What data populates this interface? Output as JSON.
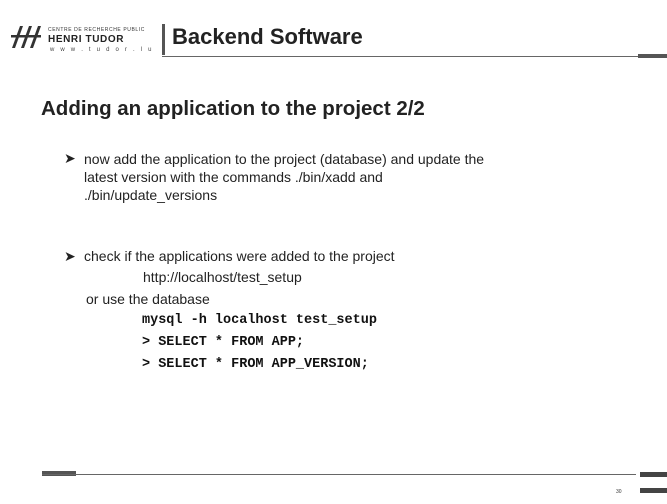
{
  "logo": {
    "small_text": "CENTRE DE RECHERCHE PUBLIC",
    "name": "HENRI TUDOR",
    "url": "w w w . t u d o r . l u"
  },
  "header": {
    "title": "Backend Software"
  },
  "slide": {
    "heading": "Adding an application to the project 2/2",
    "bullet_glyph": "➤",
    "bullet1": {
      "line1": "now add the application to the project (database) and update the",
      "line2": "latest version with the commands ./bin/xadd and",
      "line3": "./bin/update_versions"
    },
    "bullet2": {
      "line1": "check if the applications were added to the project",
      "url": "http://localhost/test_setup",
      "alt": "or use the database",
      "code1": "mysql -h localhost test_setup",
      "code2": "> SELECT * FROM APP;",
      "code3": "> SELECT * FROM APP_VERSION;"
    }
  },
  "footer": {
    "page_number": "30"
  }
}
